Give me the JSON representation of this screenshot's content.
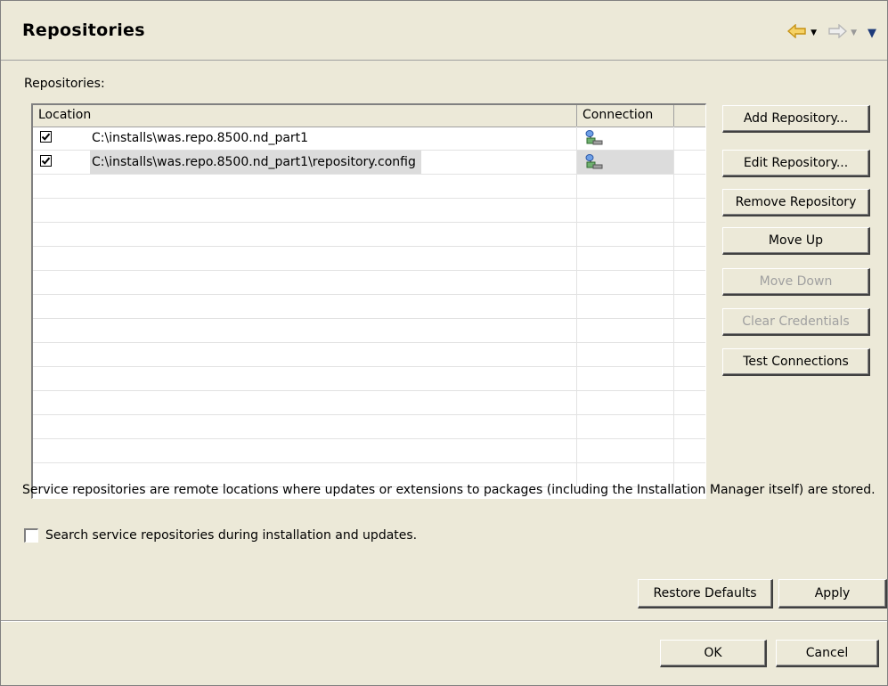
{
  "header": {
    "title": "Repositories",
    "icons": [
      "back-arrow-icon",
      "forward-arrow-icon",
      "view-menu-icon"
    ]
  },
  "section_label": "Repositories:",
  "table": {
    "columns": [
      "Location",
      "Connection",
      ""
    ],
    "rows": [
      {
        "checked": true,
        "location": "C:\\installs\\was.repo.8500.nd_part1",
        "connection_icon": "repository-connection-icon"
      },
      {
        "checked": true,
        "location": "C:\\installs\\was.repo.8500.nd_part1\\repository.config",
        "connection_icon": "repository-connection-icon"
      }
    ]
  },
  "buttons": {
    "add_repository": "Add Repository...",
    "edit_repository": "Edit Repository...",
    "remove_repository": "Remove Repository",
    "move_up": "Move Up",
    "move_down": "Move Down",
    "clear_credentials": "Clear Credentials",
    "test_connections": "Test Connections",
    "restore_defaults": "Restore Defaults",
    "apply": "Apply",
    "ok": "OK",
    "cancel": "Cancel"
  },
  "description": "Service repositories are remote locations where updates or extensions to packages (including the Installation Manager itself) are stored.",
  "option": {
    "label": "Search service repositories during installation and updates.",
    "checked": false
  },
  "colors": {
    "background": "#ece9d8",
    "back_arrow": "#f0c040",
    "selected_row": "#dcdcdc",
    "disabled_text": "#a0a0a0"
  }
}
